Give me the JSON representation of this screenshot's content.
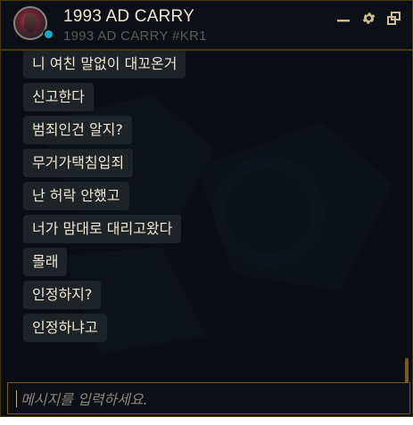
{
  "header": {
    "name": "1993 AD CARRY",
    "riot_id": "1993 AD CARRY #KR1",
    "status_color": "#1fa6c9",
    "controls": [
      {
        "icon": "minimize-icon"
      },
      {
        "icon": "gear-icon"
      },
      {
        "icon": "popout-icon"
      }
    ]
  },
  "messages": [
    "니 여친 말없이 대꼬온거",
    "신고한다",
    "범죄인건 알지?",
    "무거가택침입죄",
    "난 허락 안했고",
    "너가 맘대로 대리고왔다",
    "몰래",
    "인정하지?",
    "인정하냐고"
  ],
  "input": {
    "placeholder": "메시지를 입력하세요.",
    "value": ""
  },
  "colors": {
    "background": "#0a0d13",
    "bubble": "#1e2328",
    "text": "#f0e6d2",
    "gold": "#785a28"
  }
}
